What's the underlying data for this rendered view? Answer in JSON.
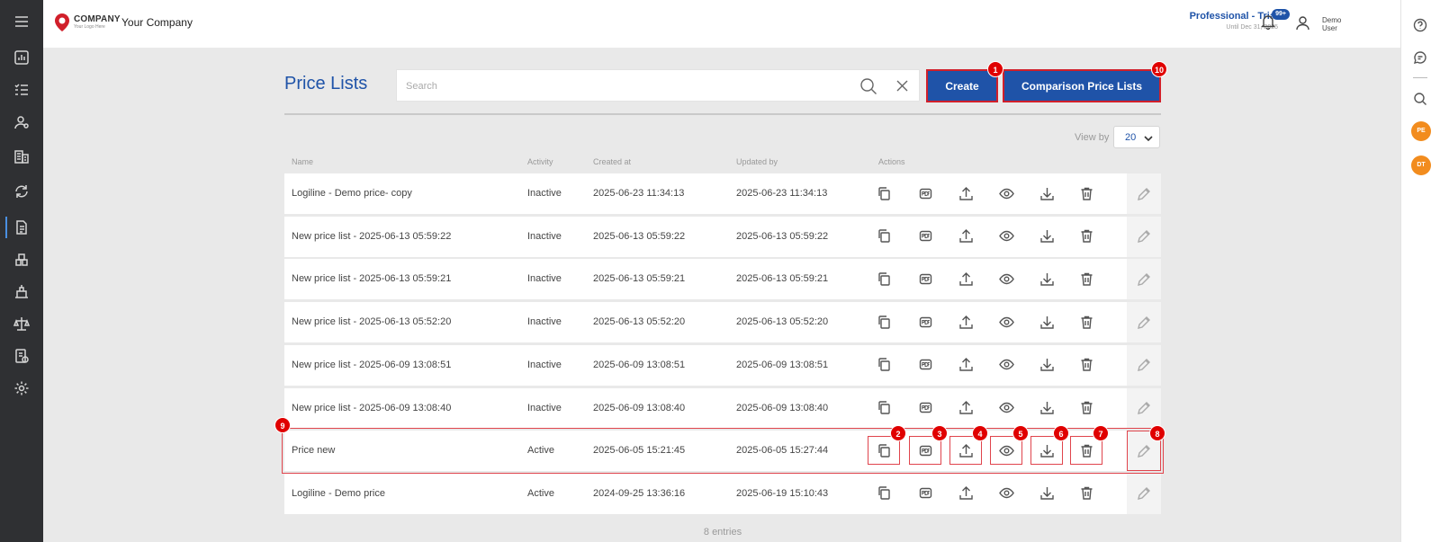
{
  "app": {
    "logo_line1": "COMPANY",
    "logo_line2": "Your Logo Here",
    "company_name": "Your Company",
    "plan_title": "Professional - Trial",
    "plan_until": "Until Dec 31, 2025",
    "notifications_badge": "99+",
    "user_name": "Demo User"
  },
  "right_rail": {
    "avatars": [
      "PE",
      "DT"
    ]
  },
  "page": {
    "title": "Price Lists",
    "search_placeholder": "Search",
    "create_label": "Create",
    "compare_label": "Comparison Price Lists",
    "view_by_label": "View by",
    "view_by_value": "20",
    "entries_text": "8 entries"
  },
  "table": {
    "columns": [
      "Name",
      "Activity",
      "Created at",
      "Updated by",
      "Actions"
    ],
    "rows": [
      {
        "name": "Logiline - Demo price- copy",
        "activity": "Inactive",
        "created": "2025-06-23 11:34:13",
        "updated": "2025-06-23 11:34:13"
      },
      {
        "name": "New price list - 2025-06-13 05:59:22",
        "activity": "Inactive",
        "created": "2025-06-13 05:59:22",
        "updated": "2025-06-13 05:59:22"
      },
      {
        "name": "New price list - 2025-06-13 05:59:21",
        "activity": "Inactive",
        "created": "2025-06-13 05:59:21",
        "updated": "2025-06-13 05:59:21"
      },
      {
        "name": "New price list - 2025-06-13 05:52:20",
        "activity": "Inactive",
        "created": "2025-06-13 05:52:20",
        "updated": "2025-06-13 05:52:20"
      },
      {
        "name": "New price list - 2025-06-09 13:08:51",
        "activity": "Inactive",
        "created": "2025-06-09 13:08:51",
        "updated": "2025-06-09 13:08:51"
      },
      {
        "name": "New price list - 2025-06-09 13:08:40",
        "activity": "Inactive",
        "created": "2025-06-09 13:08:40",
        "updated": "2025-06-09 13:08:40"
      },
      {
        "name": "Price new",
        "activity": "Active",
        "created": "2025-06-05 15:21:45",
        "updated": "2025-06-05 15:27:44"
      },
      {
        "name": "Logiline - Demo price",
        "activity": "Active",
        "created": "2024-09-25 13:36:16",
        "updated": "2025-06-19 15:10:43"
      }
    ],
    "action_icons": [
      "copy-icon",
      "pdf-icon",
      "upload-icon",
      "eye-icon",
      "download-icon",
      "trash-icon"
    ],
    "edit_icon": "pencil-icon"
  },
  "markers": [
    "1",
    "2",
    "3",
    "4",
    "5",
    "6",
    "7",
    "8",
    "9",
    "10"
  ],
  "colors": {
    "accent": "#1f53a8",
    "highlight": "#e0444c",
    "marker": "#e00000",
    "avatar": "#f28c1e",
    "nav_bg": "#2f3033"
  }
}
